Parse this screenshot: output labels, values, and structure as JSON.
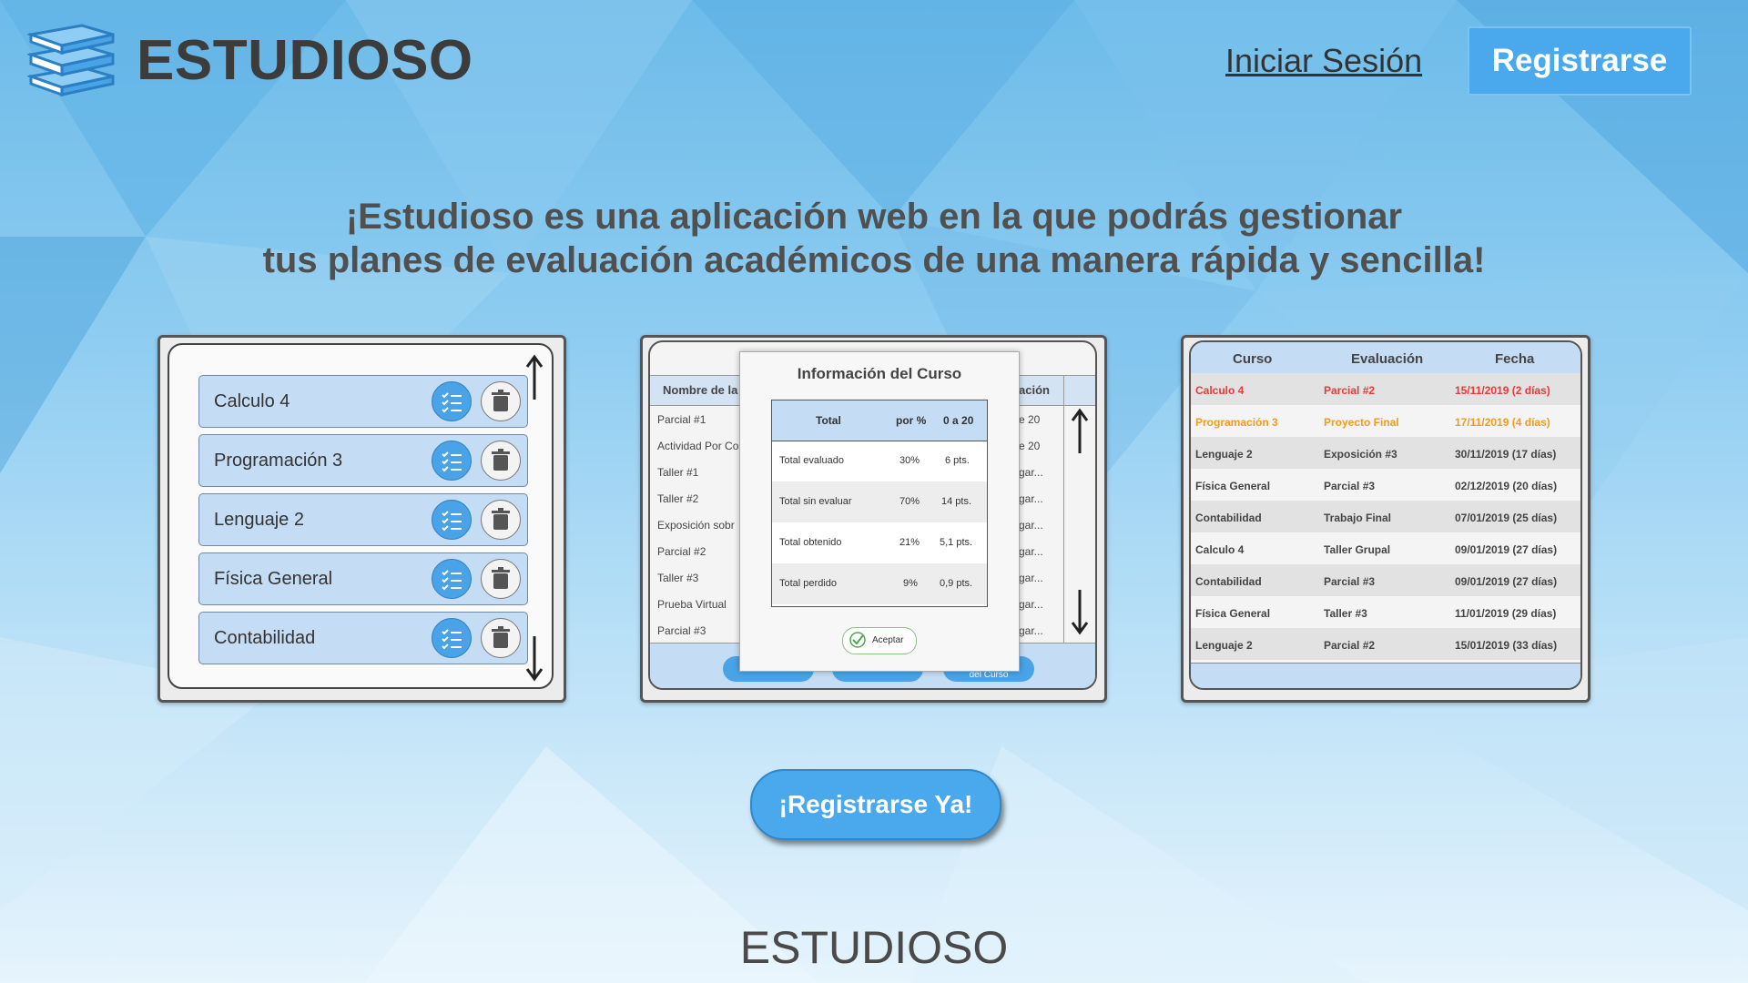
{
  "header": {
    "brand": "ESTUDIOSO",
    "login_label": "Iniciar Sesión",
    "register_label": "Registrarse"
  },
  "hero": {
    "line1": "¡Estudioso es una aplicación web en la que podrás gestionar",
    "line2": "tus planes de evaluación académicos de una manera rápida y sencilla!"
  },
  "card_courses": {
    "items": [
      {
        "label": "Calculo 4"
      },
      {
        "label": "Programación 3"
      },
      {
        "label": "Lenguaje 2"
      },
      {
        "label": "Física General"
      },
      {
        "label": "Contabilidad"
      }
    ],
    "icons": [
      "list-check-icon",
      "trash-icon",
      "arrow-up-icon",
      "arrow-down-icon"
    ]
  },
  "card_info": {
    "header_left": "Nombre de la",
    "header_right": "ación",
    "left_rows": [
      "Parcial #1",
      "Actividad Por Co",
      "Taller #1",
      "Taller #2",
      "Exposición sobr",
      "Parcial #2",
      "Taller #3",
      "Prueba Virtual",
      "Parcial #3"
    ],
    "right_rows": [
      "e 20",
      "e 20",
      "gar...",
      "gar...",
      "gar...",
      "gar...",
      "gar...",
      "gar...",
      "gar..."
    ],
    "bottom_button": "del Curso",
    "modal": {
      "title": "Información del Curso",
      "columns": [
        "Total",
        "por %",
        "0 a 20"
      ],
      "rows": [
        {
          "label": "Total evaluado",
          "pct": "30%",
          "pts": "6 pts."
        },
        {
          "label": "Total sin evaluar",
          "pct": "70%",
          "pts": "14 pts."
        },
        {
          "label": "Total obtenido",
          "pct": "21%",
          "pts": "5,1 pts."
        },
        {
          "label": "Total perdido",
          "pct": "9%",
          "pts": "0,9 pts."
        }
      ],
      "accept_label": "Aceptar"
    }
  },
  "card_schedule": {
    "columns": [
      "Curso",
      "Evaluación",
      "Fecha"
    ],
    "colors": {
      "urgent": "#e8393a",
      "warning": "#f29c1f",
      "normal": "#444444"
    },
    "rows": [
      {
        "course": "Calculo 4",
        "eval": "Parcial #2",
        "date": "15/11/2019 (2 días)",
        "status": "urgent"
      },
      {
        "course": "Programación 3",
        "eval": "Proyecto Final",
        "date": "17/11/2019 (4 días)",
        "status": "warning"
      },
      {
        "course": "Lenguaje 2",
        "eval": "Exposición #3",
        "date": "30/11/2019 (17 días)",
        "status": "normal"
      },
      {
        "course": "Física General",
        "eval": "Parcial #3",
        "date": "02/12/2019 (20 días)",
        "status": "normal"
      },
      {
        "course": "Contabilidad",
        "eval": "Trabajo Final",
        "date": "07/01/2019 (25 días)",
        "status": "normal"
      },
      {
        "course": "Calculo 4",
        "eval": "Taller Grupal",
        "date": "09/01/2019 (27 días)",
        "status": "normal"
      },
      {
        "course": "Contabilidad",
        "eval": "Parcial #3",
        "date": "09/01/2019 (27 días)",
        "status": "normal"
      },
      {
        "course": "Física General",
        "eval": "Taller #3",
        "date": "11/01/2019 (29 días)",
        "status": "normal"
      },
      {
        "course": "Lenguaje 2",
        "eval": "Parcial #2",
        "date": "15/01/2019 (33 días)",
        "status": "normal"
      }
    ]
  },
  "cta": {
    "label": "¡Registrarse Ya!"
  },
  "footer": {
    "brand": "ESTUDIOSO"
  }
}
